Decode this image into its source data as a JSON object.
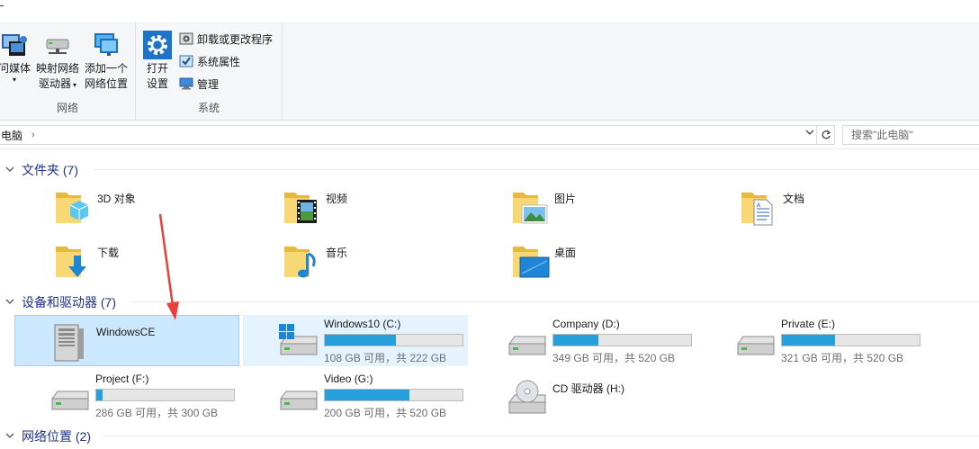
{
  "ribbon": {
    "network_group": {
      "label": "网络",
      "media_btn": "问媒体",
      "map_drive_btn": [
        "映射网络",
        "驱动器"
      ],
      "add_location_btn": [
        "添加一个",
        "网络位置"
      ]
    },
    "system_group": {
      "label": "系统",
      "open_settings_btn": [
        "打开",
        "设置"
      ],
      "uninstall": "卸载或更改程序",
      "properties": "系统属性",
      "manage": "管理"
    }
  },
  "address": {
    "crumb": "电脑",
    "separator": "›",
    "dropdown_icon": "chevron-down",
    "refresh_icon": "refresh",
    "search_placeholder": "搜索\"此电脑\""
  },
  "sections": {
    "folders": {
      "label": "文件夹 (7)"
    },
    "devices": {
      "label": "设备和驱动器 (7)"
    },
    "network": {
      "label": "网络位置 (2)"
    }
  },
  "folders": [
    {
      "name": "3D 对象",
      "icon": "3d-objects-icon"
    },
    {
      "name": "视频",
      "icon": "videos-icon"
    },
    {
      "name": "图片",
      "icon": "pictures-icon"
    },
    {
      "name": "文档",
      "icon": "documents-icon"
    },
    {
      "name": "下载",
      "icon": "downloads-icon"
    },
    {
      "name": "音乐",
      "icon": "music-icon"
    },
    {
      "name": "桌面",
      "icon": "desktop-icon"
    }
  ],
  "drives": [
    {
      "name": "WindowsCE",
      "free": "",
      "used_fraction": null,
      "state": "selected",
      "icon": "computer-tower-icon"
    },
    {
      "name": "Windows10 (C:)",
      "free": "108 GB 可用，共 222 GB",
      "used_fraction": 0.514,
      "state": "hover",
      "icon": "windows-drive-icon"
    },
    {
      "name": "Company (D:)",
      "free": "349 GB 可用，共 520 GB",
      "used_fraction": 0.329,
      "state": "normal",
      "icon": "hard-drive-icon"
    },
    {
      "name": "Private (E:)",
      "free": "321 GB 可用，共 520 GB",
      "used_fraction": 0.383,
      "state": "normal",
      "icon": "hard-drive-icon"
    },
    {
      "name": "Project (F:)",
      "free": "286 GB 可用，共 300 GB",
      "used_fraction": 0.047,
      "state": "normal",
      "icon": "hard-drive-icon"
    },
    {
      "name": "Video (G:)",
      "free": "200 GB 可用，共 520 GB",
      "used_fraction": 0.615,
      "state": "normal",
      "icon": "hard-drive-icon"
    },
    {
      "name": "CD 驱动器 (H:)",
      "free": "",
      "used_fraction": null,
      "state": "normal",
      "icon": "cd-drive-icon"
    }
  ],
  "colors": {
    "accent": "#26a0da",
    "selection_bg": "#cce8ff",
    "selection_border": "#99d1ff",
    "hover_bg": "#e5f3ff",
    "section_text": "#1e3287",
    "annotation_arrow": "#e8403a"
  }
}
